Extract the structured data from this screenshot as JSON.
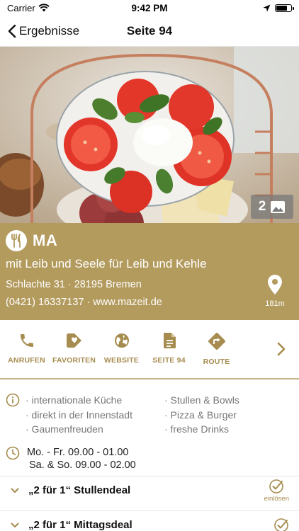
{
  "status_bar": {
    "carrier": "Carrier",
    "time": "9:42 PM",
    "battery_level": 0.8
  },
  "nav": {
    "back_label": "Ergebnisse",
    "title": "Seite 94"
  },
  "hero": {
    "photo_count": "2"
  },
  "venue": {
    "name": "MA",
    "tagline": "mit Leib und Seele für Leib und Kehle",
    "address": "Schlachte 31 · 28195 Bremen",
    "contact": "(0421) 16337137 · www.mazeit.de",
    "distance": "181m"
  },
  "actions": [
    {
      "label": "ANRUFEN",
      "icon": "phone-icon"
    },
    {
      "label": "FAVORITEN",
      "icon": "heart-tag-icon"
    },
    {
      "label": "WEBSITE",
      "icon": "globe-icon"
    },
    {
      "label": "SEITE 94",
      "icon": "document-icon"
    },
    {
      "label": "ROUTE",
      "icon": "directions-icon"
    }
  ],
  "features": {
    "left": [
      "· internationale Küche",
      "· direkt in der Innenstadt",
      "· Gaumenfreuden"
    ],
    "right": [
      "· Stullen & Bowls",
      "· Pizza & Burger",
      "· freshe Drinks"
    ]
  },
  "hours": {
    "weekday": "Mo. - Fr. 09.00 - 01.00",
    "weekend": "Sa. & So. 09.00 - 02.00"
  },
  "deals": [
    {
      "title": "„2 für 1“ Stullendeal",
      "check_label": "einlösen"
    },
    {
      "title": "„2 für 1“ Mittagsdeal",
      "check_label": ""
    }
  ],
  "colors": {
    "brand_gold": "#b39a5d",
    "accent_text": "#a68c4e"
  }
}
